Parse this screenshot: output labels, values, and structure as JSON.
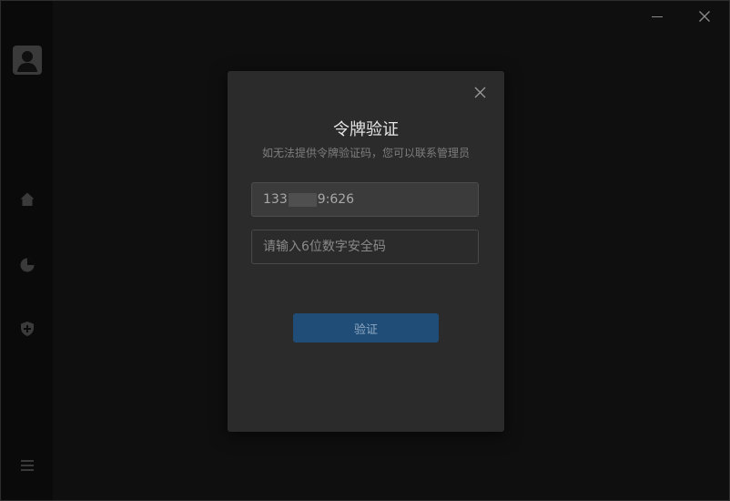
{
  "window": {
    "minimize_icon": "minimize-icon",
    "close_icon": "close-icon"
  },
  "sidebar": {
    "items": [
      {
        "icon": "user-avatar-icon"
      },
      {
        "icon": "home-icon"
      },
      {
        "icon": "chart-icon"
      },
      {
        "icon": "shield-plus-icon"
      },
      {
        "icon": "menu-icon"
      }
    ]
  },
  "modal": {
    "title": "令牌验证",
    "subtitle": "如无法提供令牌验证码，您可以联系管理员",
    "phone": {
      "prefix": "133",
      "suffix": "9:626"
    },
    "code_input": {
      "value": "",
      "placeholder": "请输入6位数字安全码"
    },
    "verify_label": "验证",
    "close_icon": "close-icon"
  },
  "colors": {
    "background": "#101010",
    "sidebar": "#0a0a0a",
    "modal": "#2b2b2b",
    "accent": "#1f4d77"
  }
}
